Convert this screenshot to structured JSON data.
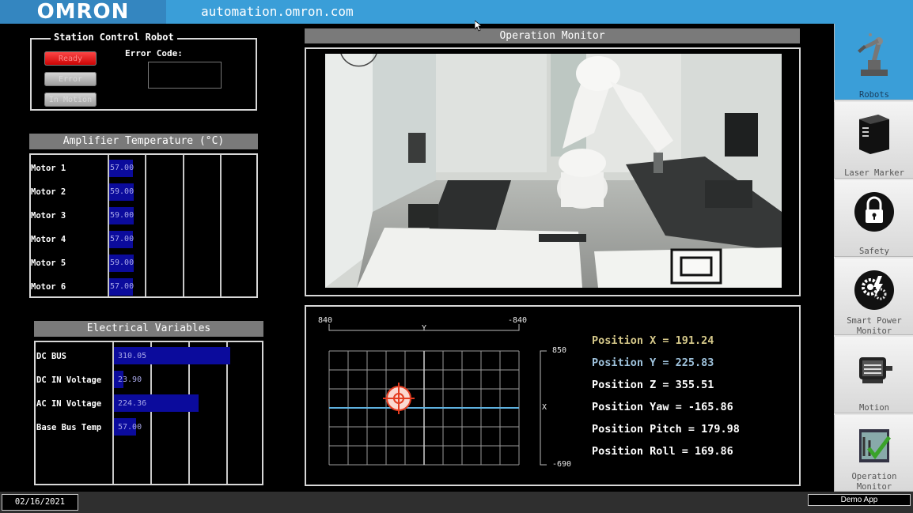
{
  "header": {
    "logo": "OMRON",
    "url": "automation.omron.com"
  },
  "station_control": {
    "title": "Station Control Robot",
    "error_code_label": "Error Code:",
    "error_code_value": "",
    "buttons": [
      {
        "label": "Ready",
        "active": true
      },
      {
        "label": "Error",
        "active": false
      },
      {
        "label": "In Motion",
        "active": false
      }
    ]
  },
  "amplifier": {
    "title": "Amplifier Temperature (°C)",
    "rows": [
      {
        "label": "Motor 1",
        "value": "57.00"
      },
      {
        "label": "Motor 2",
        "value": "59.00"
      },
      {
        "label": "Motor 3",
        "value": "59.00"
      },
      {
        "label": "Motor 4",
        "value": "57.00"
      },
      {
        "label": "Motor 5",
        "value": "59.00"
      },
      {
        "label": "Motor 6",
        "value": "57.00"
      }
    ]
  },
  "electrical": {
    "title": "Electrical Variables",
    "rows": [
      {
        "label": "DC BUS",
        "value": "310.05"
      },
      {
        "label": "DC IN Voltage",
        "value": "23.90"
      },
      {
        "label": "AC IN Voltage",
        "value": "224.36"
      },
      {
        "label": "Base Bus Temp",
        "value": "57.00"
      }
    ]
  },
  "operation_monitor": {
    "title": "Operation Monitor"
  },
  "position_plot": {
    "y_axis_label": "Y",
    "y_left": "840",
    "y_right": "-840",
    "x_axis_label": "X",
    "x_top": "850",
    "x_bottom": "-690"
  },
  "positions": [
    {
      "text": "Position X = 191.24",
      "color": "#d6c98a"
    },
    {
      "text": "Position Y = 225.83",
      "color": "#9fc3dd"
    },
    {
      "text": "Position Z = 355.51",
      "color": "#ffffff"
    },
    {
      "text": "Position Yaw = -165.86",
      "color": "#ffffff"
    },
    {
      "text": "Position Pitch = 179.98",
      "color": "#ffffff"
    },
    {
      "text": "Position Roll = 169.86",
      "color": "#ffffff"
    }
  ],
  "nav": [
    {
      "label": "Robots",
      "icon": "robot-arm-icon",
      "active": true
    },
    {
      "label": "Laser Marker",
      "icon": "laser-marker-icon",
      "active": false
    },
    {
      "label": "Safety",
      "icon": "lock-icon",
      "active": false
    },
    {
      "label": "Smart Power Monitor",
      "icon": "gears-lightning-icon",
      "active": false
    },
    {
      "label": "Motion",
      "icon": "servo-motor-icon",
      "active": false
    },
    {
      "label": "Operation Monitor",
      "icon": "monitor-checkmark-icon",
      "active": false
    }
  ],
  "footer": {
    "date": "02/16/2021",
    "app": "Demo App"
  },
  "colors": {
    "header_blue": "#3a9ed8",
    "bar_blue": "#0b0b9c",
    "ready_red": "#e00000",
    "panel_gray": "#7a7a7a"
  }
}
